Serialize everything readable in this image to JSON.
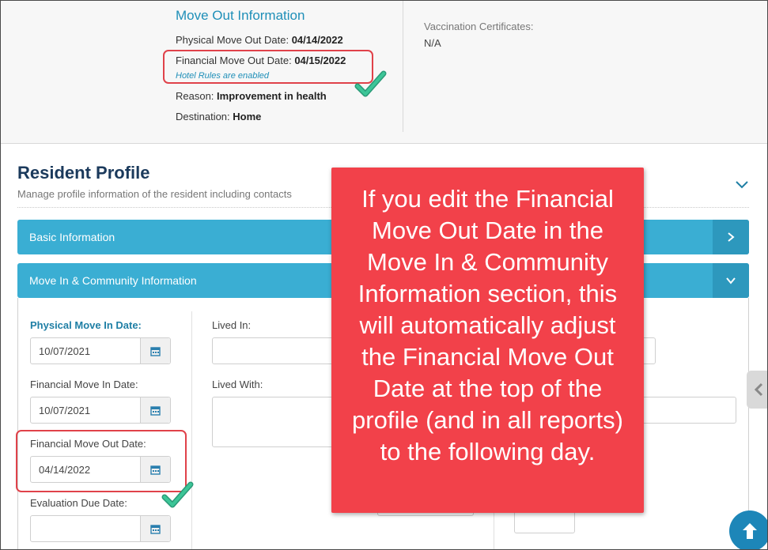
{
  "move_out": {
    "title": "Move Out Information",
    "physical_label": "Physical Move Out Date:",
    "physical_value": "04/14/2022",
    "financial_label": "Financial Move Out Date:",
    "financial_value": "04/15/2022",
    "hotel_note": "Hotel Rules are enabled",
    "reason_label": "Reason:",
    "reason_value": "Improvement in health",
    "destination_label": "Destination:",
    "destination_value": "Home"
  },
  "vaccination": {
    "label": "Vaccination Certificates:",
    "value": "N/A"
  },
  "resident_profile": {
    "title": "Resident Profile",
    "subtitle": "Manage profile information of the resident including contacts"
  },
  "sections": {
    "basic": "Basic Information",
    "move_in": "Move In & Community Information"
  },
  "fields": {
    "physical_move_in_label": "Physical Move In Date:",
    "physical_move_in_value": "10/07/2021",
    "financial_move_in_label": "Financial Move In Date:",
    "financial_move_in_value": "10/07/2021",
    "financial_move_out_label": "Financial Move Out Date:",
    "financial_move_out_value": "04/14/2022",
    "evaluation_due_label": "Evaluation Due Date:",
    "evaluation_due_value": "",
    "lived_in_label": "Lived In:",
    "lived_with_label": "Lived With:"
  },
  "callout": {
    "text": "If you edit the Financial Move Out Date in the Move In & Community Information section, this will automatically adjust the Financial Move Out Date at the top of the profile (and in all reports) to the following day."
  },
  "colors": {
    "accent": "#3aaed3",
    "callout": "#f2414a",
    "highlight_border": "#e0424a",
    "check": "#2bb38a"
  },
  "icons": {
    "calendar": "calendar-icon",
    "chevron_down": "chevron-down-icon",
    "chevron_right": "chevron-right-icon",
    "chevron_left": "chevron-left-icon",
    "arrow_up": "arrow-up-icon",
    "check": "checkmark-icon"
  }
}
